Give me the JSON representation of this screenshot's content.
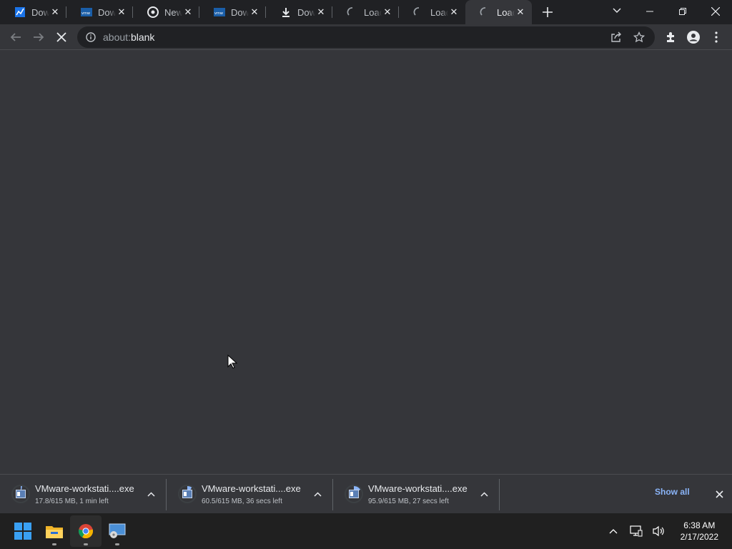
{
  "tabs": [
    {
      "title": "Down",
      "favicon": "chart-favicon-icon",
      "active": false
    },
    {
      "title": "Down",
      "favicon": "vmware-favicon-icon",
      "active": false
    },
    {
      "title": "New",
      "favicon": "chrome-favicon-icon",
      "active": false
    },
    {
      "title": "Down",
      "favicon": "vmware-favicon-icon",
      "active": false
    },
    {
      "title": "Down",
      "favicon": "download-favicon-icon",
      "active": false
    },
    {
      "title": "Loadi",
      "favicon": "loading-spinner-icon",
      "active": false
    },
    {
      "title": "Loadi",
      "favicon": "loading-spinner-icon",
      "active": false
    },
    {
      "title": "Loadi",
      "favicon": "loading-spinner-icon",
      "active": true
    }
  ],
  "omnibox": {
    "url_prefix": "about:",
    "url_host": "blank"
  },
  "downloads": [
    {
      "name": "VMware-workstati....exe",
      "status": "17.8/615 MB, 1 min left",
      "progress": 0.029
    },
    {
      "name": "VMware-workstati....exe",
      "status": "60.5/615 MB, 36 secs left",
      "progress": 0.098
    },
    {
      "name": "VMware-workstati....exe",
      "status": "95.9/615 MB, 27 secs left",
      "progress": 0.156
    }
  ],
  "shelf": {
    "show_all": "Show all"
  },
  "clock": {
    "time": "6:38 AM",
    "date": "2/17/2022"
  },
  "colors": {
    "accent": "#8ab4f8",
    "content_bg": "#35363a",
    "frame_bg": "#202124"
  }
}
